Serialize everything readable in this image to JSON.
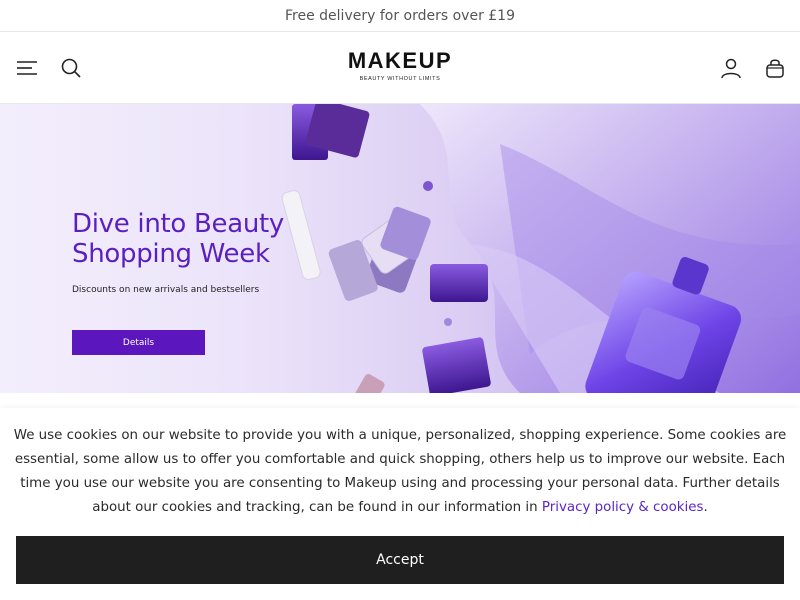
{
  "promo": {
    "text": "Free delivery for orders over £19"
  },
  "header": {
    "logo_main": "MAKEUP",
    "logo_tagline": "BEAUTY WITHOUT LIMITS",
    "icons": [
      "menu-icon",
      "search-icon",
      "user-icon",
      "shopping-bag-icon"
    ]
  },
  "hero": {
    "title": "Dive into Beauty Shopping Week",
    "subtitle": "Discounts on new arrivals and bestsellers",
    "button_label": "Details"
  },
  "cookie": {
    "text_before": "We use cookies on our website to provide you with a unique, personalized, shopping experience. Some cookies are essential, some allow us to offer you comfortable and quick shopping, others help us to improve our website. Each time you use our website you are consenting to Makeup using and processing your personal data. Further details about our cookies and tracking, can be found in our information in ",
    "link_text": "Privacy policy & cookies",
    "text_after": ".",
    "accept_label": "Accept"
  },
  "colors": {
    "accent": "#5b16bd",
    "link": "#5b24c7",
    "dark_button": "#1f1f1f"
  }
}
